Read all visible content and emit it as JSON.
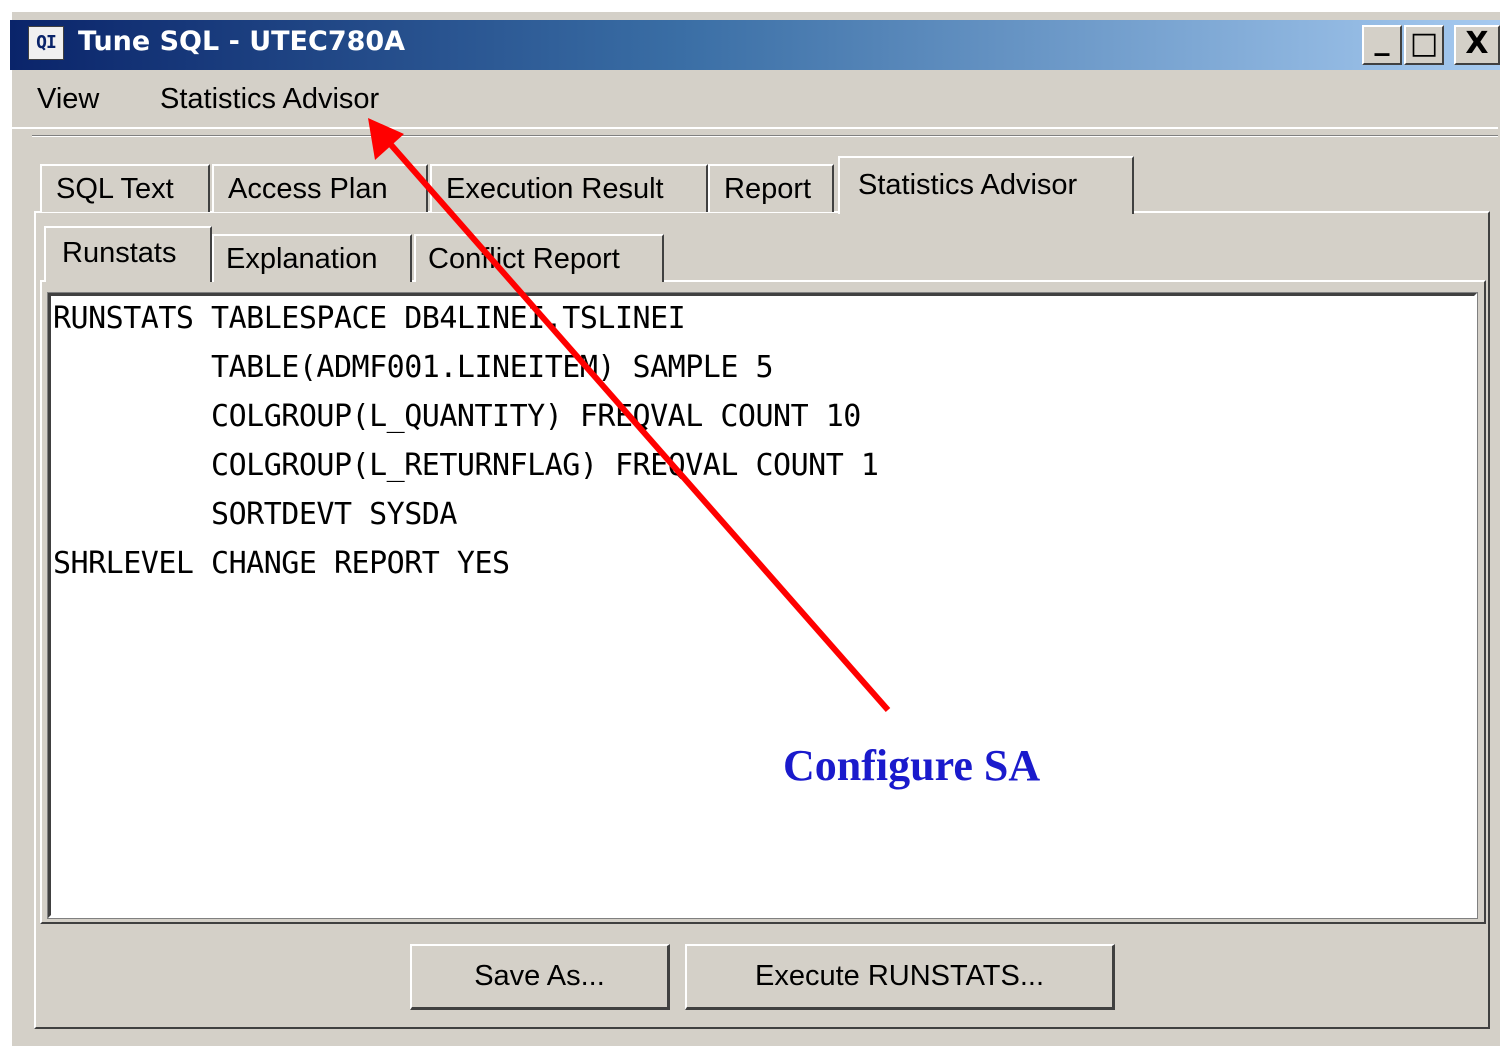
{
  "window": {
    "title": "Tune SQL - UTEC780A",
    "app_icon_text": "QI",
    "controls": {
      "minimize": "_",
      "maximize": "□",
      "close": "X"
    }
  },
  "menubar": {
    "items": [
      "View",
      "Statistics Advisor"
    ]
  },
  "main_tabs": {
    "items": [
      "SQL Text",
      "Access Plan",
      "Execution Result",
      "Report",
      "Statistics Advisor"
    ],
    "selected": "Statistics Advisor"
  },
  "sub_tabs": {
    "items": [
      "Runstats",
      "Explanation",
      "Conflict Report"
    ],
    "selected": "Runstats"
  },
  "runstats": {
    "lines": [
      "RUNSTATS TABLESPACE DB4LINEI.TSLINEI",
      "         TABLE(ADMF001.LINEITEM) SAMPLE 5",
      "         COLGROUP(L_QUANTITY) FREQVAL COUNT 10",
      "         COLGROUP(L_RETURNFLAG) FREQVAL COUNT 1",
      "         SORTDEVT SYSDA",
      "SHRLEVEL CHANGE REPORT YES"
    ]
  },
  "buttons": {
    "save_as": "Save As...",
    "execute_runstats": "Execute RUNSTATS..."
  },
  "annotation": {
    "text": "Configure SA",
    "text_color": "#1a1acc",
    "arrow_color": "#ff0000"
  }
}
